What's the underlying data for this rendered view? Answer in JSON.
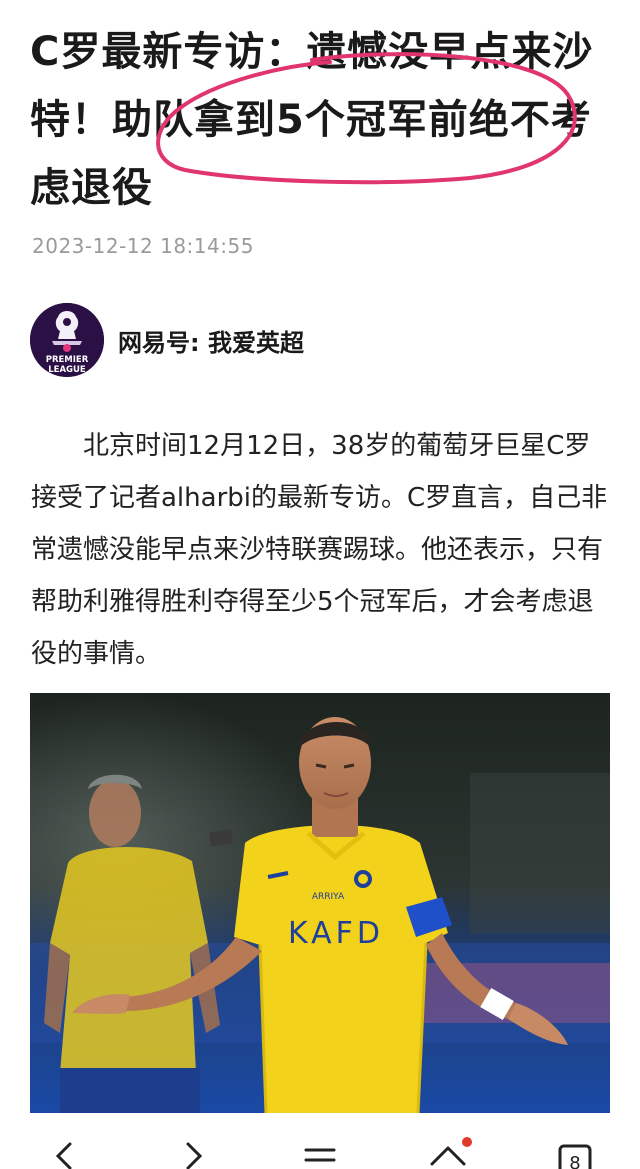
{
  "article": {
    "title": "C罗最新专访：遗憾没早点来沙特！助队拿到5个冠军前绝不考虑退役",
    "timestamp": "2023-12-12 18:14:55",
    "author": "网易号: 我爱英超",
    "avatar_text": "PREMIER LEAGUE",
    "body": "北京时间12月12日，38岁的葡萄牙巨星C罗接受了记者alharbi的最新专访。C罗直言，自己非常遗憾没能早点来沙特联赛踢球。他还表示，只有帮助利雅得胜利夺得至少5个冠军后，才会考虑退役的事情。"
  },
  "photo": {
    "jersey_brand": "ARRIYA",
    "jersey_sponsor": "KAFD"
  },
  "bottom_nav": {
    "tab_count": "8",
    "home_notification": true
  },
  "colors": {
    "highlight": "#e0356e",
    "jersey": "#f2d21b",
    "captain_band": "#1f4fc9",
    "notification_dot": "#e03a2a"
  }
}
